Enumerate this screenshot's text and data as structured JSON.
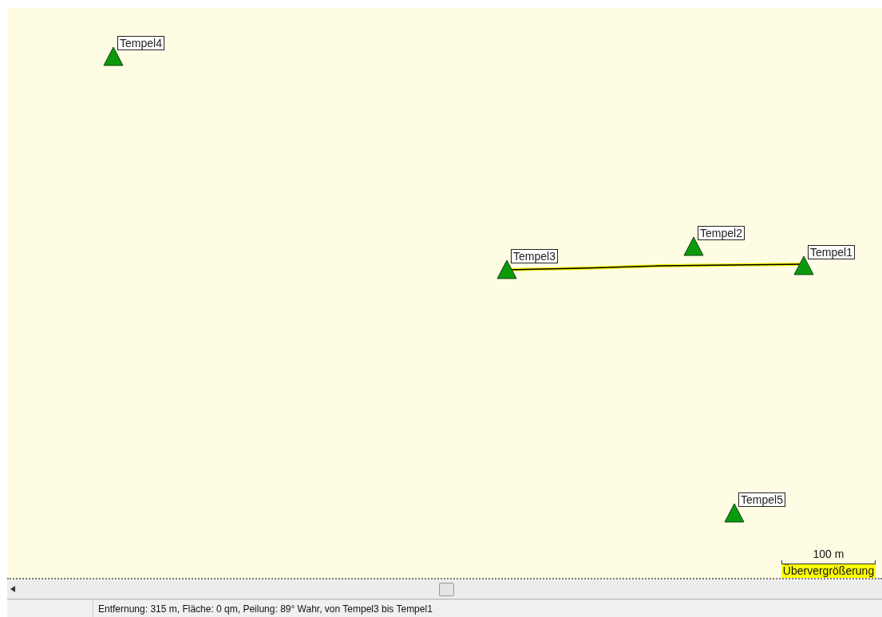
{
  "map": {
    "waypoints": [
      {
        "label": "Tempel4"
      },
      {
        "label": "Tempel2"
      },
      {
        "label": "Tempel3"
      },
      {
        "label": "Tempel1"
      },
      {
        "label": "Tempel5"
      }
    ],
    "scale": {
      "distance": "100 m",
      "zoom_warning": "Übervergrößerung"
    }
  },
  "status_bar": {
    "text": "Entfernung: 315 m, Fläche: 0 qm, Peilung: 89° Wahr, von Tempel3 bis Tempel1"
  }
}
